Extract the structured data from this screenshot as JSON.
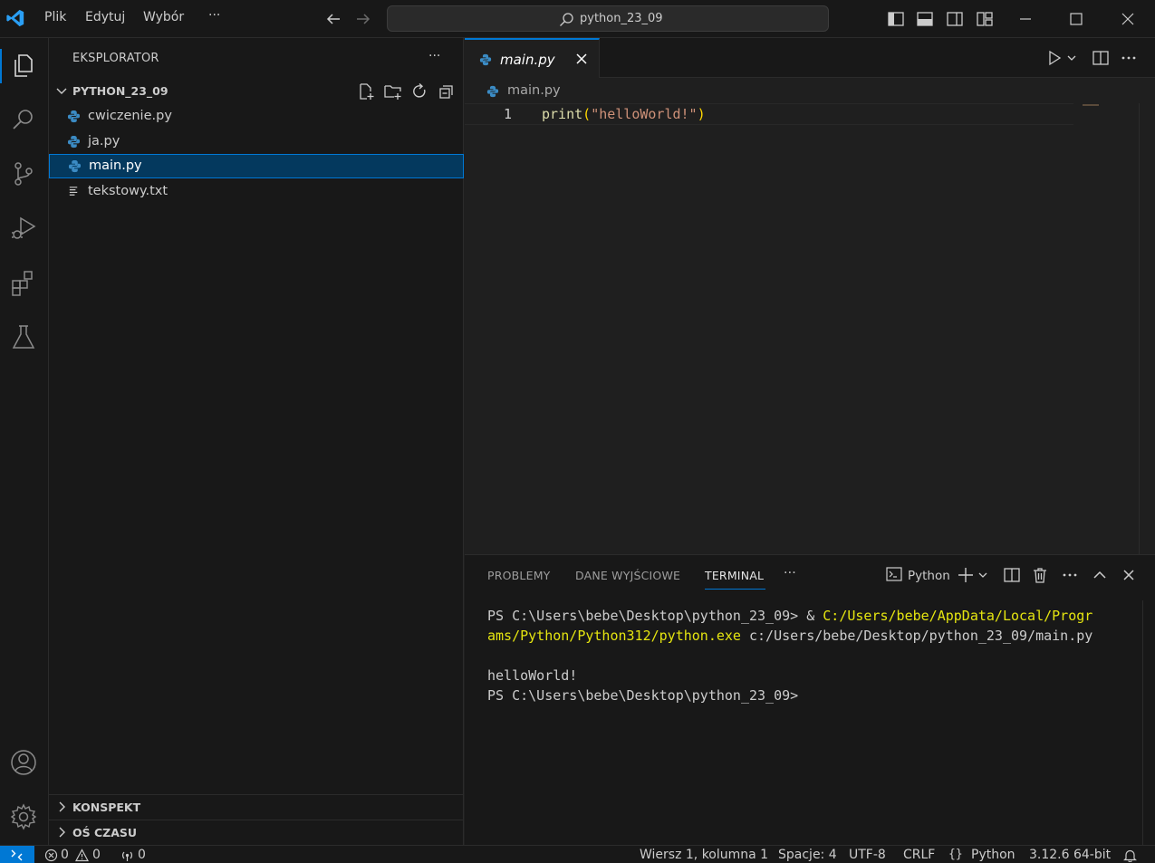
{
  "menu": {
    "file": "Plik",
    "edit": "Edytuj",
    "selection": "Wybór",
    "more": "···"
  },
  "command_center": {
    "text": "python_23_09"
  },
  "sidebar": {
    "title": "EKSPLORATOR",
    "more": "···",
    "folder": "PYTHON_23_09",
    "files": [
      {
        "name": "cwiczenie.py",
        "icon": "python-icon"
      },
      {
        "name": "ja.py",
        "icon": "python-icon"
      },
      {
        "name": "main.py",
        "icon": "python-icon",
        "selected": true
      },
      {
        "name": "tekstowy.txt",
        "icon": "text-file-icon"
      }
    ],
    "outline": "KONSPEKT",
    "timeline": "OŚ CZASU"
  },
  "editor": {
    "tab_label": "main.py",
    "breadcrumb": "main.py",
    "line_number": "1",
    "code": {
      "fn": "print",
      "open": "(",
      "str": "\"helloWorld!\"",
      "close": ")"
    }
  },
  "panel": {
    "tabs": [
      "PROBLEMY",
      "DANE WYJŚCIOWE",
      "TERMINAL"
    ],
    "more": "···",
    "terminal_profile": "Python",
    "terminal": {
      "l1_prompt": "PS C:\\Users\\bebe\\Desktop\\python_23_09> & ",
      "l1_cmd": "C:/Users/bebe/AppData/Local/Progr",
      "l2_cmd": "ams/Python/Python312/python.exe",
      "l2_arg": " c:/Users/bebe/Desktop/python_23_09/main.py",
      "output": "helloWorld!",
      "prompt": "PS C:\\Users\\bebe\\Desktop\\python_23_09>"
    }
  },
  "status": {
    "errors": "0",
    "warnings": "0",
    "ports": "0",
    "position": "Wiersz 1, kolumna 1",
    "spaces": "Spacje: 4",
    "encoding": "UTF-8",
    "eol": "CRLF",
    "language": "Python",
    "interpreter": "3.12.6 64-bit"
  },
  "colors": {
    "accent": "#0078d4",
    "background": "#1f1f1f",
    "sidebar": "#181818",
    "selection": "#04395e"
  }
}
